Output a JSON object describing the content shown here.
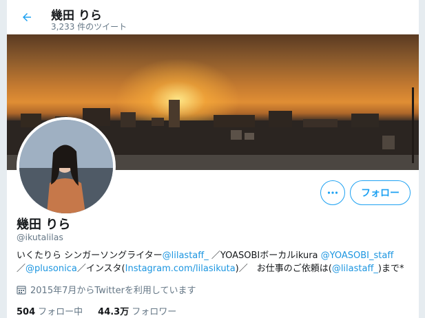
{
  "header": {
    "title": "幾田 りら",
    "tweet_count": "3,233 件のツイート"
  },
  "profile": {
    "name": "幾田 りら",
    "handle": "@ikutalilas",
    "follow_label": "フォロー",
    "bio": {
      "part1": "いくたりら シンガーソングライター",
      "link1": "@lilastaff_",
      "part2": " ／YOASOBIボーカルikura ",
      "link2": "@YOASOBI_staff",
      "part3": "／",
      "link3": "@plusonica",
      "part4": "／インスタ(",
      "link4": "Instagram.com/lilasikuta",
      "part5": ")／　お仕事のご依頼は(",
      "link5": "@lilastaff_",
      "part6": ")まで*"
    },
    "joined": "2015年7月からTwitterを利用しています",
    "following_count": "504",
    "following_label": "フォロー中",
    "followers_count": "44.3万",
    "followers_label": "フォロワー"
  },
  "colors": {
    "accent": "#1da1f2",
    "link": "#1b95e0",
    "secondary_text": "#657786"
  },
  "icons": {
    "back": "back-arrow-icon",
    "more": "more-dots-icon",
    "calendar": "calendar-icon"
  }
}
